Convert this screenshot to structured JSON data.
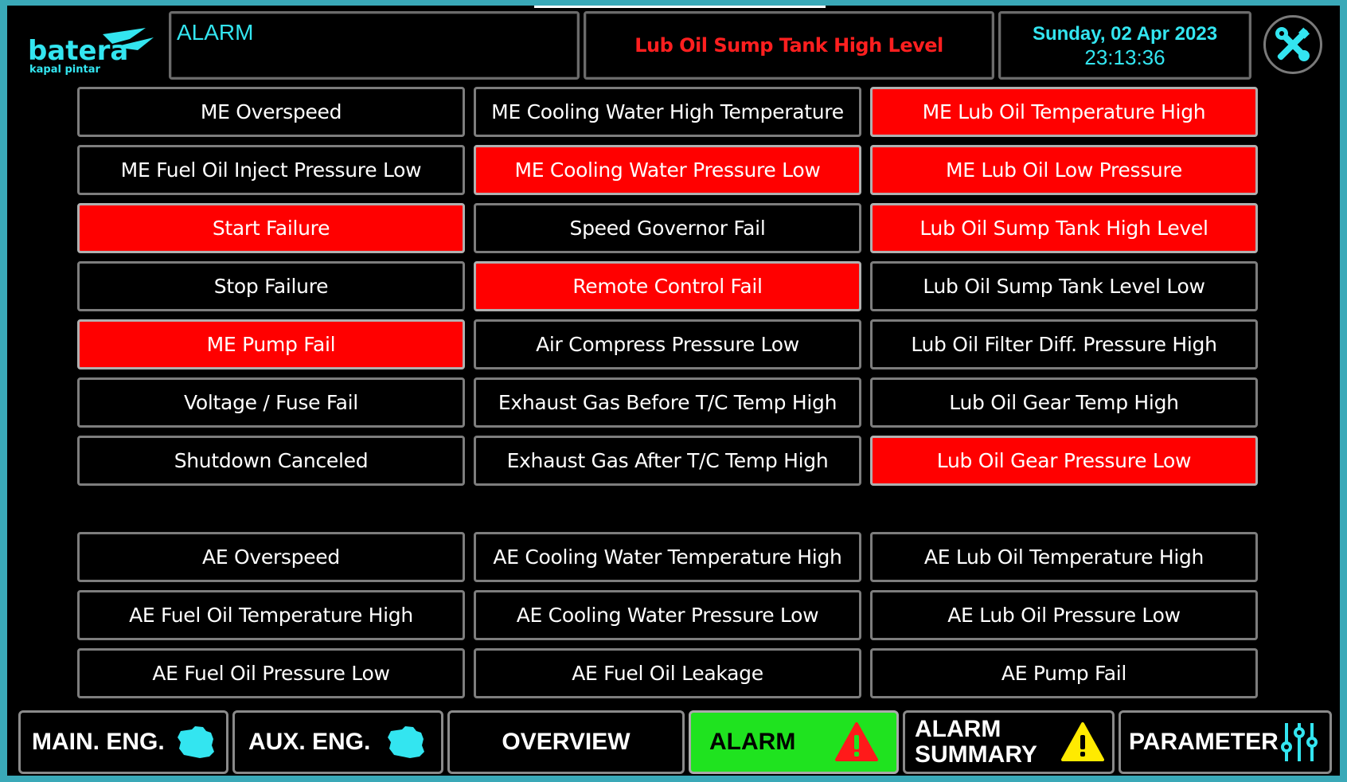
{
  "brand": {
    "name": "batera",
    "tagline": "kapal pintar"
  },
  "header": {
    "title": "ALARM",
    "active_alarm": "Lub Oil Sump Tank High Level",
    "date": "Sunday, 02 Apr 2023",
    "time": "23:13:36"
  },
  "colors": {
    "active": "#ff0000",
    "accent": "#33e5f0",
    "selected_nav": "#1fe31f"
  },
  "me_alarms": [
    {
      "label": "ME Overspeed",
      "active": false
    },
    {
      "label": "ME Cooling Water High Temperature",
      "active": false
    },
    {
      "label": "ME Lub Oil Temperature High",
      "active": true
    },
    {
      "label": "ME Fuel Oil Inject Pressure Low",
      "active": false
    },
    {
      "label": "ME Cooling Water Pressure Low",
      "active": true
    },
    {
      "label": "ME Lub Oil Low Pressure",
      "active": true
    },
    {
      "label": "Start Failure",
      "active": true
    },
    {
      "label": "Speed Governor Fail",
      "active": false
    },
    {
      "label": "Lub Oil Sump Tank High Level",
      "active": true
    },
    {
      "label": "Stop Failure",
      "active": false
    },
    {
      "label": "Remote Control Fail",
      "active": true
    },
    {
      "label": "Lub Oil Sump Tank Level Low",
      "active": false
    },
    {
      "label": "ME Pump Fail",
      "active": true
    },
    {
      "label": "Air Compress Pressure Low",
      "active": false
    },
    {
      "label": "Lub Oil Filter Diff. Pressure High",
      "active": false
    },
    {
      "label": "Voltage / Fuse Fail",
      "active": false
    },
    {
      "label": "Exhaust Gas Before T/C Temp High",
      "active": false
    },
    {
      "label": "Lub Oil Gear Temp High",
      "active": false
    },
    {
      "label": "Shutdown Canceled",
      "active": false
    },
    {
      "label": "Exhaust Gas After T/C Temp High",
      "active": false
    },
    {
      "label": "Lub Oil Gear Pressure Low",
      "active": true
    }
  ],
  "ae_alarms": [
    {
      "label": "AE Overspeed",
      "active": false
    },
    {
      "label": "AE Cooling Water Temperature High",
      "active": false
    },
    {
      "label": "AE Lub Oil Temperature High",
      "active": false
    },
    {
      "label": "AE Fuel Oil Temperature High",
      "active": false
    },
    {
      "label": "AE Cooling Water Pressure Low",
      "active": false
    },
    {
      "label": "AE Lub Oil Pressure Low",
      "active": false
    },
    {
      "label": "AE Fuel Oil Pressure Low",
      "active": false
    },
    {
      "label": "AE Fuel Oil Leakage",
      "active": false
    },
    {
      "label": "AE Pump Fail",
      "active": false
    }
  ],
  "nav": {
    "main": "MAIN. ENG.",
    "aux": "AUX. ENG.",
    "overview": "OVERVIEW",
    "alarm": "ALARM",
    "summary_line1": "ALARM",
    "summary_line2": "SUMMARY",
    "parameter": "PARAMETER",
    "selected": "alarm"
  }
}
